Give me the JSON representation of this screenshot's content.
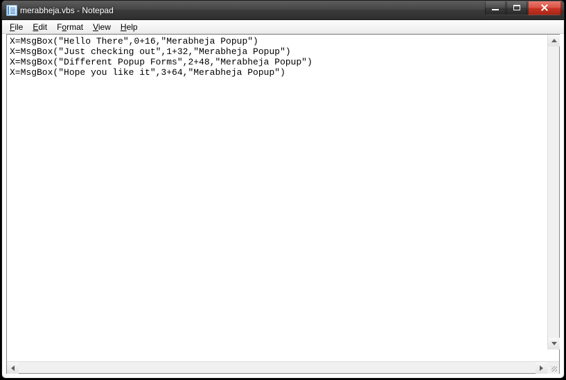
{
  "title": "merabheja.vbs - Notepad",
  "menu": {
    "file": "File",
    "edit": "Edit",
    "format": "Format",
    "view": "View",
    "help": "Help"
  },
  "editor_content": "X=MsgBox(\"Hello There\",0+16,\"Merabheja Popup\")\nX=MsgBox(\"Just checking out\",1+32,\"Merabheja Popup\")\nX=MsgBox(\"Different Popup Forms\",2+48,\"Merabheja Popup\")\nX=MsgBox(\"Hope you like it\",3+64,\"Merabheja Popup\")"
}
